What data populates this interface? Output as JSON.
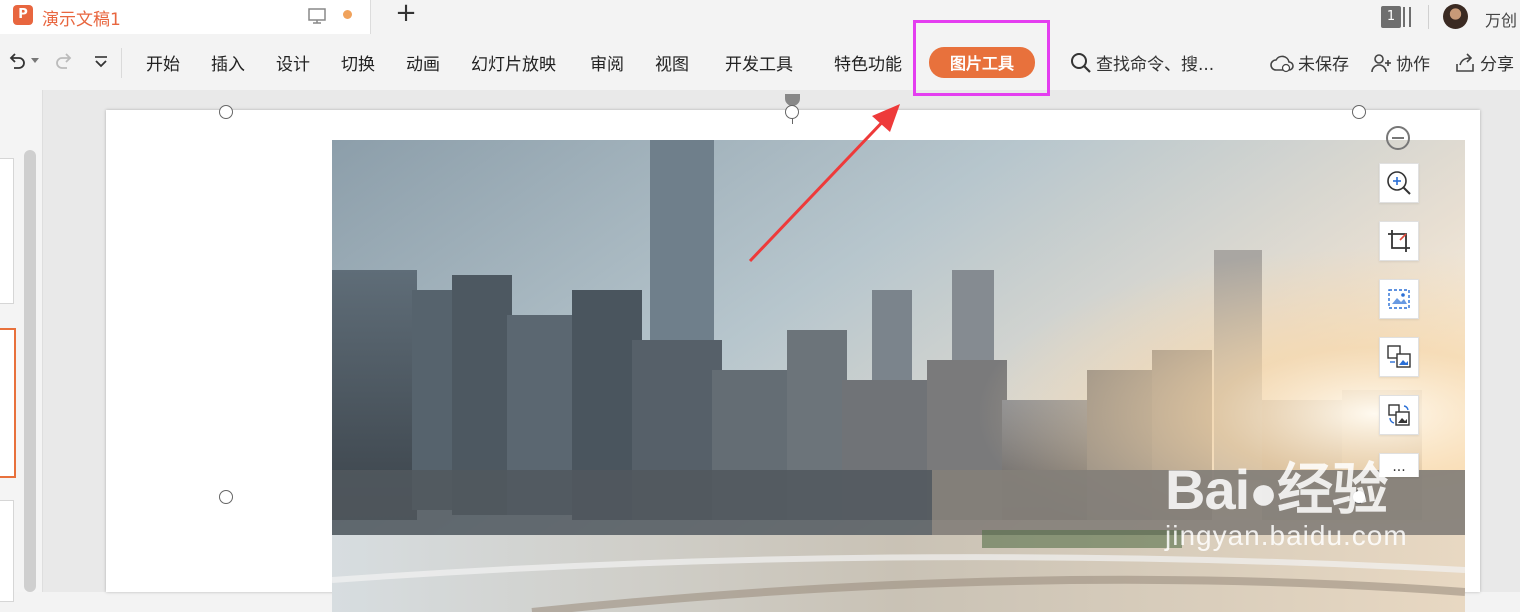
{
  "window": {
    "doc_title": "演示文稿1",
    "app_logo_letter": "P",
    "window_count": "1",
    "user_name": "万创"
  },
  "menu": {
    "items": [
      "开始",
      "插入",
      "设计",
      "切换",
      "动画",
      "幻灯片放映",
      "审阅",
      "视图",
      "开发工具",
      "特色功能"
    ],
    "active_tab": "图片工具",
    "search_placeholder": "查找命令、搜..."
  },
  "actions": {
    "unsaved": "未保存",
    "collaborate": "协作",
    "share": "分享"
  },
  "watermark": {
    "brand_left": "Bai",
    "brand_right": "经验",
    "site": "jingyan.baidu.com"
  },
  "colors": {
    "accent": "#e8713c",
    "title_accent": "#e8663f",
    "highlight_box": "#e43ef0",
    "annotation_arrow": "#ee3a3a"
  },
  "icons": {
    "undo": "undo-icon",
    "redo": "redo-icon",
    "customize": "chevron-down-icon",
    "search": "search-icon",
    "cloud": "cloud-icon",
    "collaborate": "add-user-icon",
    "share": "share-icon"
  }
}
